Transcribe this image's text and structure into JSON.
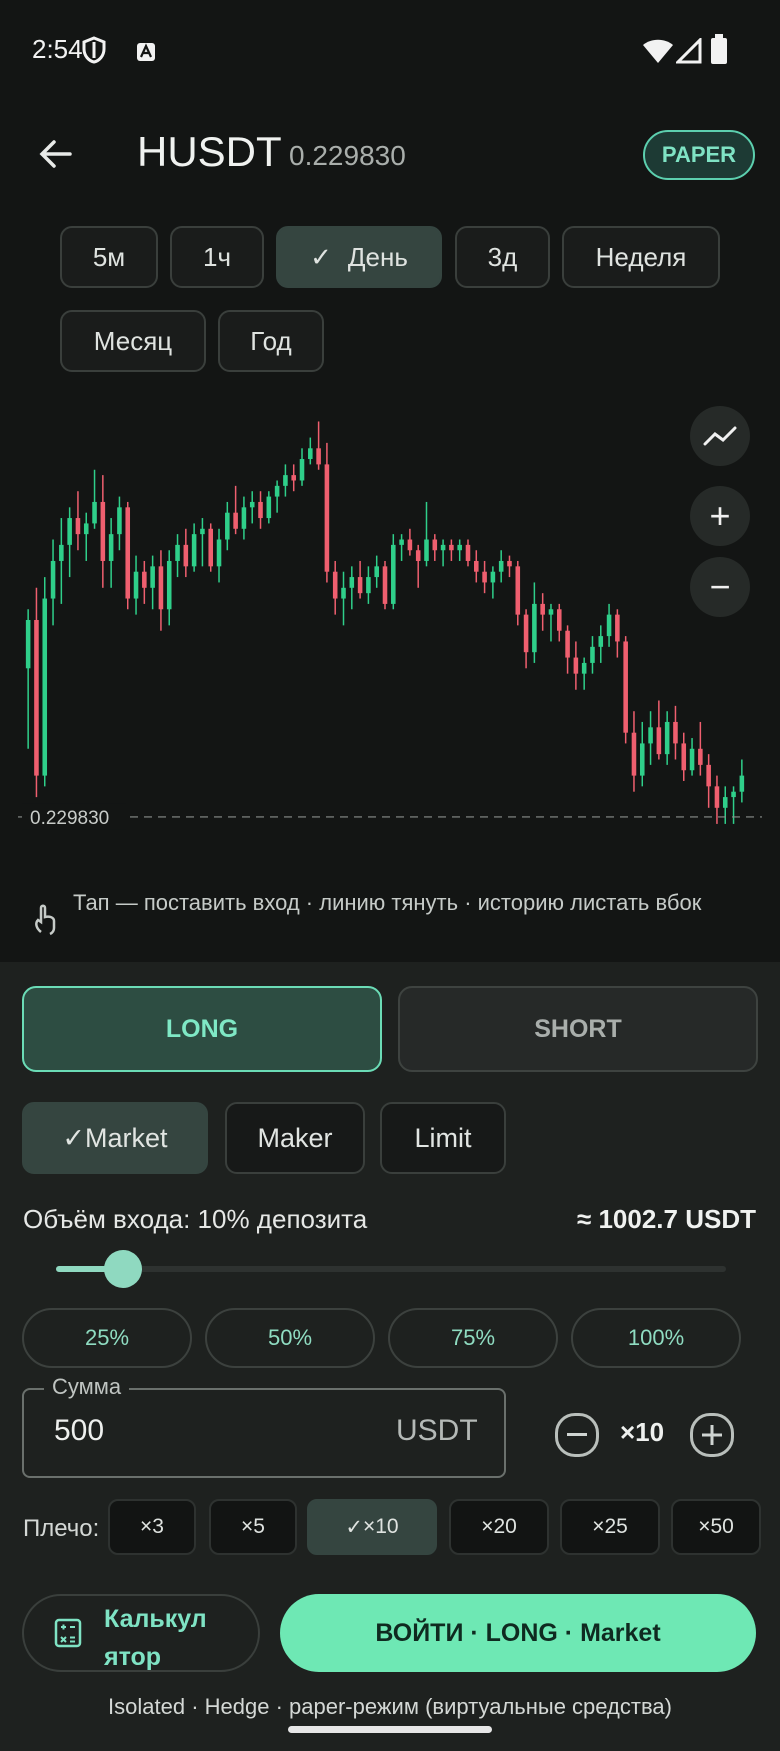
{
  "status": {
    "time": "2:54",
    "icons": [
      "shield-icon",
      "a-icon",
      "wifi-icon",
      "signal-icon",
      "battery-icon"
    ]
  },
  "header": {
    "title": "HUSDT",
    "price": "0.229830",
    "mode_badge": "PAPER"
  },
  "timeframes": [
    {
      "label": "5м",
      "selected": false
    },
    {
      "label": "1ч",
      "selected": false
    },
    {
      "label": "День",
      "selected": true
    },
    {
      "label": "3д",
      "selected": false
    },
    {
      "label": "Неделя",
      "selected": false
    },
    {
      "label": "Месяц",
      "selected": false
    },
    {
      "label": "Год",
      "selected": false
    }
  ],
  "chart_data": {
    "type": "candlestick",
    "current_price_label": "0.229830",
    "current_price": 0.22983,
    "up_color": "#2fcf8a",
    "down_color": "#ef5f6f",
    "candles": [
      [
        0.2326,
        0.2337,
        0.2311,
        0.2335
      ],
      [
        0.2335,
        0.2341,
        0.2302,
        0.2306
      ],
      [
        0.2306,
        0.2343,
        0.2304,
        0.2339
      ],
      [
        0.2339,
        0.235,
        0.2334,
        0.2346
      ],
      [
        0.2346,
        0.2354,
        0.2338,
        0.2349
      ],
      [
        0.2349,
        0.2356,
        0.2343,
        0.2354
      ],
      [
        0.2354,
        0.2359,
        0.2348,
        0.2351
      ],
      [
        0.2351,
        0.2355,
        0.2346,
        0.2353
      ],
      [
        0.2353,
        0.2363,
        0.2352,
        0.2357
      ],
      [
        0.2357,
        0.2362,
        0.2341,
        0.2346
      ],
      [
        0.2346,
        0.2354,
        0.2341,
        0.2351
      ],
      [
        0.2351,
        0.2358,
        0.2348,
        0.2356
      ],
      [
        0.2356,
        0.2357,
        0.2337,
        0.2339
      ],
      [
        0.2339,
        0.2347,
        0.2336,
        0.2344
      ],
      [
        0.2344,
        0.2346,
        0.2338,
        0.2341
      ],
      [
        0.2341,
        0.2347,
        0.2337,
        0.2345
      ],
      [
        0.2345,
        0.2348,
        0.2333,
        0.2337
      ],
      [
        0.2337,
        0.2348,
        0.2334,
        0.2346
      ],
      [
        0.2346,
        0.2351,
        0.2343,
        0.2349
      ],
      [
        0.2349,
        0.2352,
        0.2343,
        0.2345
      ],
      [
        0.2345,
        0.2353,
        0.2344,
        0.2351
      ],
      [
        0.2351,
        0.2354,
        0.2345,
        0.2352
      ],
      [
        0.2352,
        0.2353,
        0.2344,
        0.2345
      ],
      [
        0.2345,
        0.2352,
        0.2342,
        0.235
      ],
      [
        0.235,
        0.2357,
        0.2348,
        0.2355
      ],
      [
        0.2355,
        0.236,
        0.2351,
        0.2352
      ],
      [
        0.2352,
        0.2358,
        0.235,
        0.2356
      ],
      [
        0.2356,
        0.2359,
        0.2353,
        0.2357
      ],
      [
        0.2357,
        0.2359,
        0.2352,
        0.2354
      ],
      [
        0.2354,
        0.2359,
        0.2353,
        0.2358
      ],
      [
        0.2358,
        0.2361,
        0.2355,
        0.236
      ],
      [
        0.236,
        0.2364,
        0.2358,
        0.2362
      ],
      [
        0.2362,
        0.2364,
        0.2359,
        0.2361
      ],
      [
        0.2361,
        0.2367,
        0.236,
        0.2365
      ],
      [
        0.2365,
        0.2369,
        0.2364,
        0.2367
      ],
      [
        0.2367,
        0.2372,
        0.2363,
        0.2364
      ],
      [
        0.2364,
        0.2368,
        0.2342,
        0.2344
      ],
      [
        0.2344,
        0.2346,
        0.2336,
        0.2339
      ],
      [
        0.2339,
        0.2344,
        0.2334,
        0.2341
      ],
      [
        0.2341,
        0.2345,
        0.2337,
        0.2343
      ],
      [
        0.2343,
        0.2346,
        0.2339,
        0.234
      ],
      [
        0.234,
        0.2345,
        0.2338,
        0.2343
      ],
      [
        0.2343,
        0.2347,
        0.2341,
        0.2345
      ],
      [
        0.2345,
        0.2346,
        0.2337,
        0.2338
      ],
      [
        0.2338,
        0.2351,
        0.2337,
        0.2349
      ],
      [
        0.2349,
        0.2351,
        0.2346,
        0.235
      ],
      [
        0.235,
        0.2352,
        0.2347,
        0.2348
      ],
      [
        0.2348,
        0.2349,
        0.2341,
        0.2346
      ],
      [
        0.2346,
        0.2357,
        0.2345,
        0.235
      ],
      [
        0.235,
        0.2351,
        0.2346,
        0.2348
      ],
      [
        0.2348,
        0.235,
        0.2345,
        0.2349
      ],
      [
        0.2349,
        0.235,
        0.2346,
        0.2348
      ],
      [
        0.2348,
        0.235,
        0.2346,
        0.2349
      ],
      [
        0.2349,
        0.235,
        0.2345,
        0.2346
      ],
      [
        0.2346,
        0.2348,
        0.2342,
        0.2344
      ],
      [
        0.2344,
        0.2346,
        0.234,
        0.2342
      ],
      [
        0.2342,
        0.2345,
        0.2339,
        0.2344
      ],
      [
        0.2344,
        0.2348,
        0.2342,
        0.2346
      ],
      [
        0.2346,
        0.2347,
        0.2343,
        0.2345
      ],
      [
        0.2345,
        0.2346,
        0.2334,
        0.2336
      ],
      [
        0.2336,
        0.2337,
        0.2326,
        0.2329
      ],
      [
        0.2329,
        0.2342,
        0.2327,
        0.2338
      ],
      [
        0.2338,
        0.234,
        0.2333,
        0.2336
      ],
      [
        0.2336,
        0.2338,
        0.2331,
        0.2337
      ],
      [
        0.2337,
        0.2338,
        0.2331,
        0.2333
      ],
      [
        0.2333,
        0.2334,
        0.2325,
        0.2328
      ],
      [
        0.2328,
        0.2331,
        0.2322,
        0.2325
      ],
      [
        0.2325,
        0.2328,
        0.2322,
        0.2327
      ],
      [
        0.2327,
        0.2332,
        0.2325,
        0.233
      ],
      [
        0.233,
        0.2334,
        0.2327,
        0.2332
      ],
      [
        0.2332,
        0.2338,
        0.233,
        0.2336
      ],
      [
        0.2336,
        0.2337,
        0.2328,
        0.2331
      ],
      [
        0.2331,
        0.2332,
        0.2312,
        0.2314
      ],
      [
        0.2314,
        0.2318,
        0.2303,
        0.2306
      ],
      [
        0.2306,
        0.2316,
        0.2304,
        0.2312
      ],
      [
        0.2312,
        0.2318,
        0.2308,
        0.2315
      ],
      [
        0.2315,
        0.232,
        0.2309,
        0.231
      ],
      [
        0.231,
        0.2318,
        0.2308,
        0.2316
      ],
      [
        0.2316,
        0.2319,
        0.2309,
        0.2312
      ],
      [
        0.2312,
        0.2314,
        0.2305,
        0.2307
      ],
      [
        0.2307,
        0.2313,
        0.2306,
        0.2311
      ],
      [
        0.2311,
        0.2316,
        0.2306,
        0.2308
      ],
      [
        0.2308,
        0.231,
        0.23,
        0.2304
      ],
      [
        0.2304,
        0.2306,
        0.2297,
        0.23
      ],
      [
        0.23,
        0.2304,
        0.2297,
        0.2302
      ],
      [
        0.2302,
        0.2304,
        0.2297,
        0.2303
      ],
      [
        0.2303,
        0.2309,
        0.2301,
        0.2306
      ]
    ]
  },
  "chart_controls": {
    "indicator": "chart-line-icon",
    "zoom_in": "+",
    "zoom_out": "−"
  },
  "hint": "Тап — поставить вход · линию тянуть · историю листать вбок",
  "sides": {
    "long": "LONG",
    "short": "SHORT",
    "selected": "LONG"
  },
  "order_types": [
    {
      "label": "Market",
      "selected": true
    },
    {
      "label": "Maker",
      "selected": false
    },
    {
      "label": "Limit",
      "selected": false
    }
  ],
  "volume": {
    "label": "Объём входа: 10% депозита",
    "value": "≈ 1002.7 USDT",
    "percent": 10
  },
  "percent_presets": [
    "25%",
    "50%",
    "75%",
    "100%"
  ],
  "amount": {
    "label": "Сумма",
    "value": "500",
    "unit": "USDT"
  },
  "leverage": {
    "current": "×10",
    "label": "Плечо:",
    "options": [
      {
        "label": "×3",
        "selected": false
      },
      {
        "label": "×5",
        "selected": false
      },
      {
        "label": "×10",
        "selected": true
      },
      {
        "label": "×20",
        "selected": false
      },
      {
        "label": "×25",
        "selected": false
      },
      {
        "label": "×50",
        "selected": false
      }
    ]
  },
  "actions": {
    "calculator": "Калькул ятор",
    "enter": "ВОЙТИ · LONG · Market"
  },
  "footer": "Isolated · Hedge · paper-режим (виртуальные средства)",
  "colors": {
    "accent": "#6ee8b4",
    "background": "#131514",
    "panel": "#1e211f"
  }
}
